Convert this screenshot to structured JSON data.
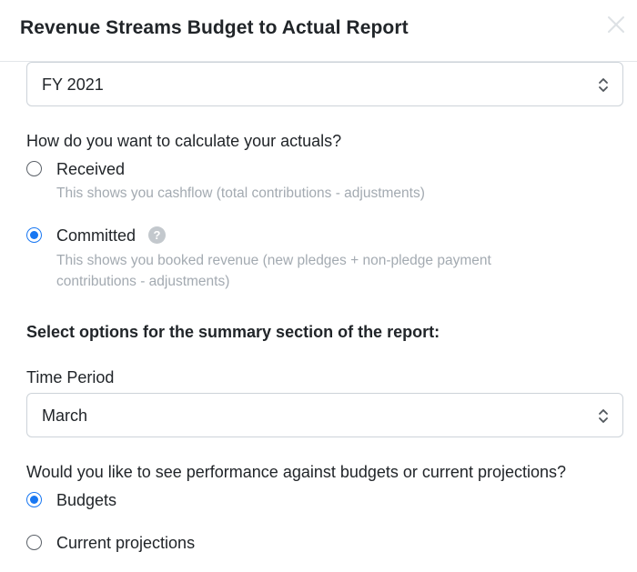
{
  "modal": {
    "title": "Revenue Streams Budget to Actual Report",
    "close_icon": "close-icon"
  },
  "fiscal_year": {
    "selected": "FY 2021"
  },
  "actuals": {
    "question": "How do you want to calculate your actuals?",
    "options": [
      {
        "label": "Received",
        "checked": false,
        "description": "This shows you cashflow (total contributions - adjustments)"
      },
      {
        "label": "Committed",
        "checked": true,
        "description_line1": "This shows you booked revenue (new pledges + non-pledge payment",
        "description_line2": "contributions - adjustments)",
        "help_icon": "?"
      }
    ]
  },
  "summary": {
    "heading": "Select options for the summary section of the report:",
    "time_period_label": "Time Period",
    "time_period_selected": "March"
  },
  "performance": {
    "question": "Would you like to see performance against budgets or current projections?",
    "options": [
      {
        "label": "Budgets",
        "checked": true
      },
      {
        "label": "Current projections",
        "checked": false
      }
    ]
  },
  "colors": {
    "accent": "#1877f2",
    "hint_text": "#a3aab1",
    "border": "#cdd3d9"
  }
}
